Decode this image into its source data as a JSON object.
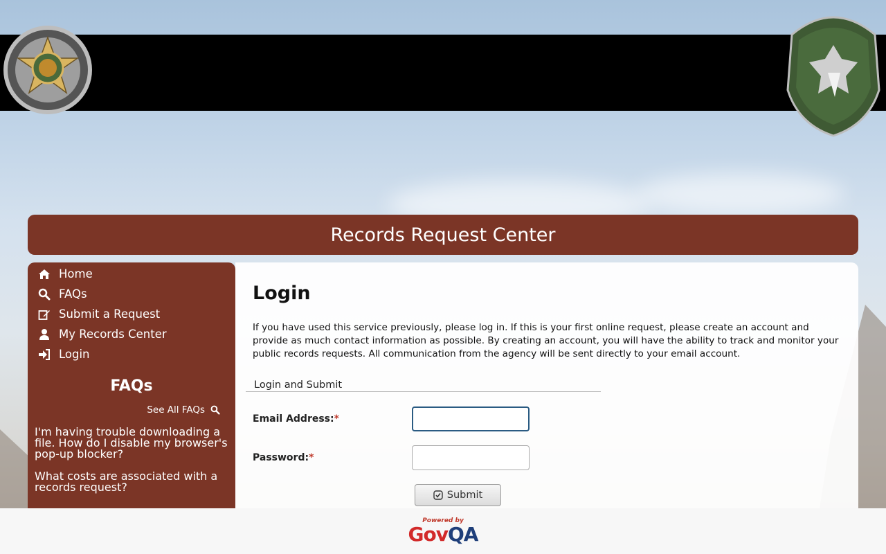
{
  "banner": {
    "title": "Records Request Center"
  },
  "nav": {
    "items": [
      {
        "label": "Home",
        "icon": "home-icon"
      },
      {
        "label": "FAQs",
        "icon": "search-icon"
      },
      {
        "label": "Submit a Request",
        "icon": "edit-icon"
      },
      {
        "label": "My Records Center",
        "icon": "user-icon"
      },
      {
        "label": "Login",
        "icon": "sign-in-icon"
      }
    ]
  },
  "sidebar_faqs": {
    "title": "FAQs",
    "see_all": "See All FAQs",
    "items": [
      "I'm having trouble downloading a file. How do I disable my browser's pop-up blocker?",
      "What costs are associated with a records request?"
    ]
  },
  "main": {
    "heading": "Login",
    "intro": "If you have used this service previously, please log in. If this is your first online request, please create an account and provide as much contact information as possible. By creating an account, you will have the ability to track and monitor your public records requests. All communication from the agency will be sent directly to your email account.",
    "section_legend": "Login and Submit",
    "email_label": "Email Address:",
    "password_label": "Password:",
    "required_mark": "*",
    "email_value": "",
    "password_value": "",
    "submit_label": "Submit"
  },
  "footer": {
    "powered_by": "Powered by",
    "brand_gov": "Gov",
    "brand_qa": "QA"
  },
  "colors": {
    "brand": "#7b3526",
    "header_band": "#000000",
    "focus_border": "#2a5b82",
    "required": "#c0392b"
  }
}
